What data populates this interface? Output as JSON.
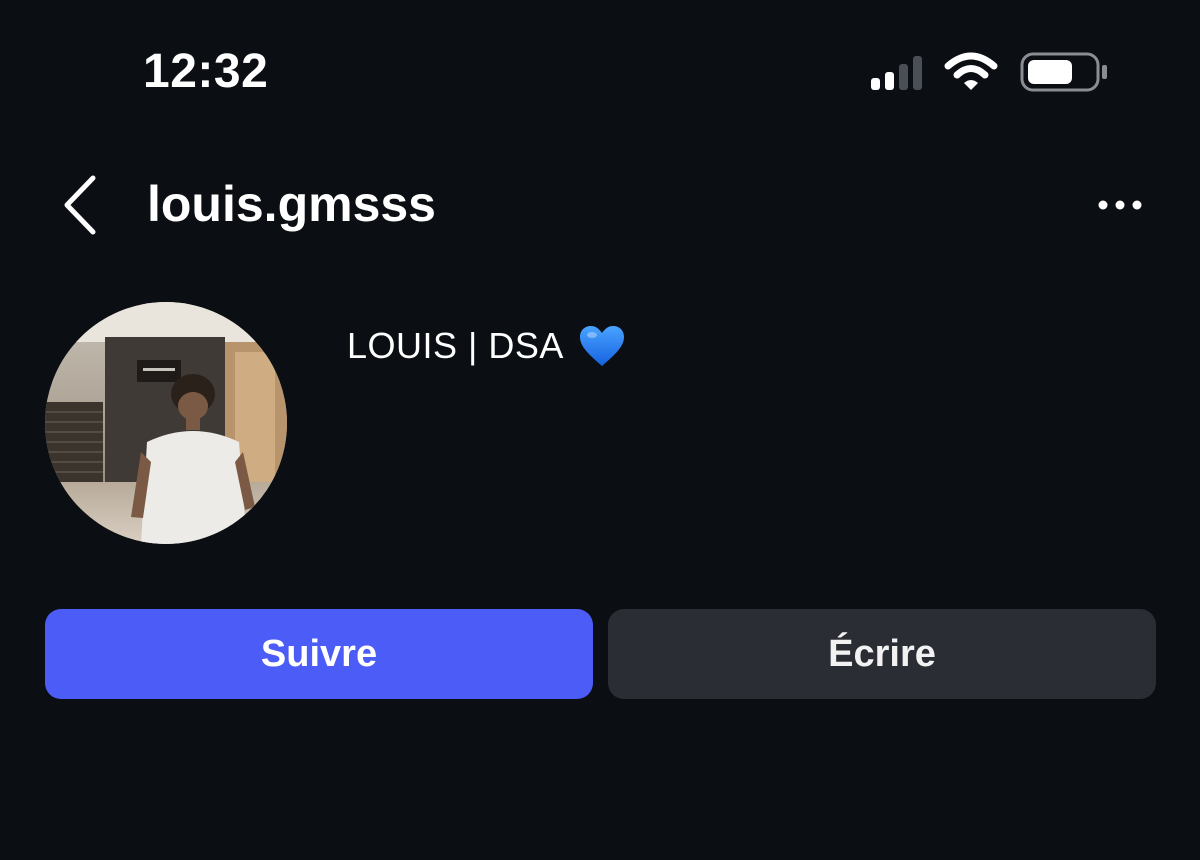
{
  "status_bar": {
    "time": "12:32",
    "icons": [
      "signal-icon",
      "wifi-icon",
      "battery-icon"
    ]
  },
  "header": {
    "back_icon": "chevron-left-icon",
    "username": "louis.gmsss",
    "more_icon": "more-horizontal-icon"
  },
  "profile": {
    "avatar_alt": "profile-photo",
    "display_name": "LOUIS | DSA",
    "emoji_icon": "blue-heart-icon"
  },
  "actions": {
    "follow_label": "Suivre",
    "message_label": "Écrire"
  },
  "colors": {
    "background": "#0b0f14",
    "follow_button": "#4b5cf7",
    "message_button": "#2a2d33",
    "heart": "#1f7cf2"
  }
}
